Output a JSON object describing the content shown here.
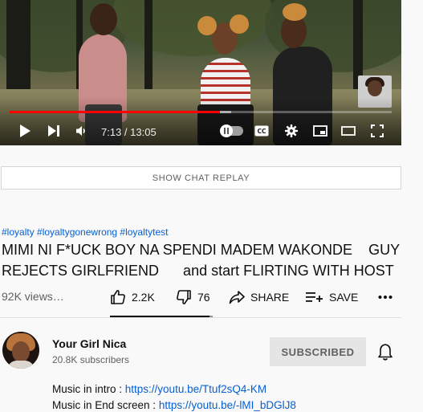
{
  "player": {
    "time_current": "7:13",
    "time_total": "13:05",
    "time_separator": " / ",
    "progress_fraction": 0.551,
    "buffer_fraction": 0.58,
    "autoplay_on": false,
    "accent_color": "#ff0000"
  },
  "chat_replay": {
    "label": "SHOW CHAT REPLAY"
  },
  "video": {
    "hashtags": "#loyalty #loyaltygonewrong #loyaltytest",
    "title_line1": "MIMI NI F*UCK BOY NA SPENDI MADEM WAKONDE  GUY",
    "title_line2": "REJECTS GIRLFRIEND   and start FLIRTING WITH HOST",
    "views": "92K views…"
  },
  "actions": {
    "like_count": "2.2K",
    "dislike_count": "76",
    "share_label": "SHARE",
    "save_label": "SAVE",
    "like_ratio": 0.967
  },
  "channel": {
    "name": "Your Girl Nica",
    "subscribers": "20.8K subscribers",
    "subscribed_label": "SUBSCRIBED"
  },
  "description": {
    "line1_text": "Music in intro : ",
    "line1_link": "https://youtu.be/Ttuf2sQ4-KM",
    "line2_text": "Music in End screen : ",
    "line2_link": "https://youtu.be/-lMI_bDGlJ8"
  },
  "icons": {
    "play": "play-icon",
    "next": "next-icon",
    "volume": "volume-icon",
    "autoplay": "autoplay-toggle",
    "captions": "captions-icon",
    "settings": "gear-icon",
    "miniplayer": "miniplayer-icon",
    "theater": "theater-icon",
    "fullscreen": "fullscreen-icon",
    "like": "thumbs-up-icon",
    "dislike": "thumbs-down-icon",
    "share": "share-icon",
    "save": "playlist-add-icon",
    "more": "more-horizontal-icon",
    "bell": "bell-icon"
  }
}
